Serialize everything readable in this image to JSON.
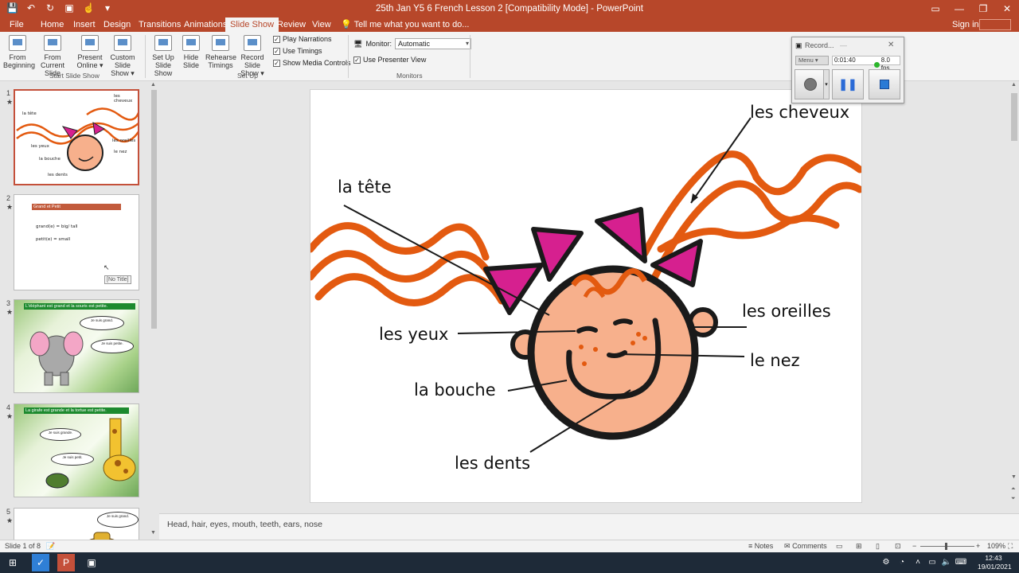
{
  "window": {
    "title": "25th Jan Y5 6 French Lesson 2 [Compatibility Mode] - PowerPoint"
  },
  "tabs": [
    {
      "label": "File",
      "active": false
    },
    {
      "label": "Home",
      "active": false
    },
    {
      "label": "Insert",
      "active": false
    },
    {
      "label": "Design",
      "active": false
    },
    {
      "label": "Transitions",
      "active": false
    },
    {
      "label": "Animations",
      "active": false
    },
    {
      "label": "Slide Show",
      "active": true
    },
    {
      "label": "Review",
      "active": false
    },
    {
      "label": "View",
      "active": false
    }
  ],
  "tell_me": "Tell me what you want to do...",
  "sign_in": "Sign in",
  "ribbon": {
    "buttons": [
      {
        "line1": "From",
        "line2": "Beginning"
      },
      {
        "line1": "From",
        "line2": "Current Slide"
      },
      {
        "line1": "Present",
        "line2": "Online ▾"
      },
      {
        "line1": "Custom Slide",
        "line2": "Show ▾"
      },
      {
        "line1": "Set Up",
        "line2": "Slide Show"
      },
      {
        "line1": "Hide",
        "line2": "Slide"
      },
      {
        "line1": "Rehearse",
        "line2": "Timings"
      },
      {
        "line1": "Record Slide",
        "line2": "Show ▾"
      }
    ],
    "checkboxes": [
      {
        "label": "Play Narrations",
        "checked": true
      },
      {
        "label": "Use Timings",
        "checked": true
      },
      {
        "label": "Show Media Controls",
        "checked": true
      }
    ],
    "monitor_label": "Monitor:",
    "monitor_value": "Automatic",
    "presenter_view": {
      "label": "Use Presenter View",
      "checked": true
    },
    "groups": [
      "Start Slide Show",
      "Set Up",
      "Monitors"
    ]
  },
  "thumbnails": {
    "numbers": [
      "1",
      "2",
      "3",
      "4",
      "5"
    ],
    "slide1_labels": [
      "les cheveux",
      "la tête",
      "les yeux",
      "les oreilles",
      "le nez",
      "la bouche",
      "les dents"
    ],
    "slide2": {
      "title": "Grand et Petit",
      "line1": "grand(e) =   big/ tall",
      "line2": "petit(e) =   small",
      "tooltip": "[No Title]"
    },
    "slide3": {
      "title": "L'éléphant est grand et la souris est petite.",
      "bubble1": "Je suis grand.",
      "bubble2": "Je suis petite."
    },
    "slide4": {
      "title": "La girafe est grande et la tortue est petite.",
      "bubble1": "Je suis grande.",
      "bubble2": "Je suis petit."
    },
    "slide5": {
      "bubble1": "Je suis grand."
    }
  },
  "slide": {
    "labels": {
      "cheveux": "les cheveux",
      "tete": "la tête",
      "yeux": "les yeux",
      "oreilles": "les oreilles",
      "nez": "le nez",
      "bouche": "la bouche",
      "dents": "les dents"
    },
    "colors": {
      "hair": "#e35a10",
      "bow": "#d6208f",
      "skin": "#f7b08c",
      "freckles": "#e35a10"
    }
  },
  "notes": "Head, hair, eyes, mouth, teeth, ears, nose",
  "status": {
    "slide_of": "Slide 1 of 8",
    "notes": "Notes",
    "comments": "Comments",
    "zoom": "109%"
  },
  "recorder": {
    "title": "Record...",
    "menu": "Menu",
    "time": "0:01:40",
    "fps": "8.0 fps"
  },
  "clock": {
    "time": "12:43",
    "date": "19/01/2021"
  }
}
